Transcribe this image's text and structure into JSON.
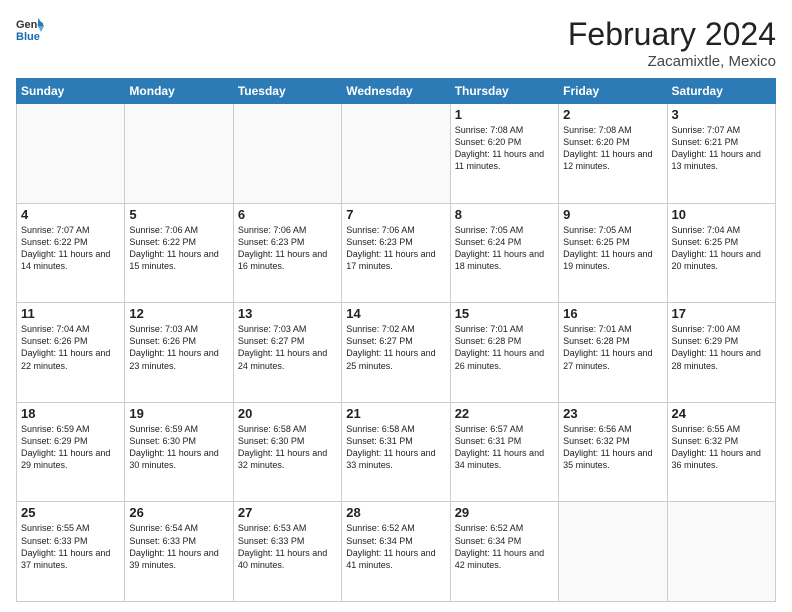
{
  "header": {
    "logo_general": "General",
    "logo_blue": "Blue",
    "month_year": "February 2024",
    "location": "Zacamixtle, Mexico"
  },
  "weekdays": [
    "Sunday",
    "Monday",
    "Tuesday",
    "Wednesday",
    "Thursday",
    "Friday",
    "Saturday"
  ],
  "weeks": [
    [
      {
        "day": "",
        "info": ""
      },
      {
        "day": "",
        "info": ""
      },
      {
        "day": "",
        "info": ""
      },
      {
        "day": "",
        "info": ""
      },
      {
        "day": "1",
        "info": "Sunrise: 7:08 AM\nSunset: 6:20 PM\nDaylight: 11 hours\nand 11 minutes."
      },
      {
        "day": "2",
        "info": "Sunrise: 7:08 AM\nSunset: 6:20 PM\nDaylight: 11 hours\nand 12 minutes."
      },
      {
        "day": "3",
        "info": "Sunrise: 7:07 AM\nSunset: 6:21 PM\nDaylight: 11 hours\nand 13 minutes."
      }
    ],
    [
      {
        "day": "4",
        "info": "Sunrise: 7:07 AM\nSunset: 6:22 PM\nDaylight: 11 hours\nand 14 minutes."
      },
      {
        "day": "5",
        "info": "Sunrise: 7:06 AM\nSunset: 6:22 PM\nDaylight: 11 hours\nand 15 minutes."
      },
      {
        "day": "6",
        "info": "Sunrise: 7:06 AM\nSunset: 6:23 PM\nDaylight: 11 hours\nand 16 minutes."
      },
      {
        "day": "7",
        "info": "Sunrise: 7:06 AM\nSunset: 6:23 PM\nDaylight: 11 hours\nand 17 minutes."
      },
      {
        "day": "8",
        "info": "Sunrise: 7:05 AM\nSunset: 6:24 PM\nDaylight: 11 hours\nand 18 minutes."
      },
      {
        "day": "9",
        "info": "Sunrise: 7:05 AM\nSunset: 6:25 PM\nDaylight: 11 hours\nand 19 minutes."
      },
      {
        "day": "10",
        "info": "Sunrise: 7:04 AM\nSunset: 6:25 PM\nDaylight: 11 hours\nand 20 minutes."
      }
    ],
    [
      {
        "day": "11",
        "info": "Sunrise: 7:04 AM\nSunset: 6:26 PM\nDaylight: 11 hours\nand 22 minutes."
      },
      {
        "day": "12",
        "info": "Sunrise: 7:03 AM\nSunset: 6:26 PM\nDaylight: 11 hours\nand 23 minutes."
      },
      {
        "day": "13",
        "info": "Sunrise: 7:03 AM\nSunset: 6:27 PM\nDaylight: 11 hours\nand 24 minutes."
      },
      {
        "day": "14",
        "info": "Sunrise: 7:02 AM\nSunset: 6:27 PM\nDaylight: 11 hours\nand 25 minutes."
      },
      {
        "day": "15",
        "info": "Sunrise: 7:01 AM\nSunset: 6:28 PM\nDaylight: 11 hours\nand 26 minutes."
      },
      {
        "day": "16",
        "info": "Sunrise: 7:01 AM\nSunset: 6:28 PM\nDaylight: 11 hours\nand 27 minutes."
      },
      {
        "day": "17",
        "info": "Sunrise: 7:00 AM\nSunset: 6:29 PM\nDaylight: 11 hours\nand 28 minutes."
      }
    ],
    [
      {
        "day": "18",
        "info": "Sunrise: 6:59 AM\nSunset: 6:29 PM\nDaylight: 11 hours\nand 29 minutes."
      },
      {
        "day": "19",
        "info": "Sunrise: 6:59 AM\nSunset: 6:30 PM\nDaylight: 11 hours\nand 30 minutes."
      },
      {
        "day": "20",
        "info": "Sunrise: 6:58 AM\nSunset: 6:30 PM\nDaylight: 11 hours\nand 32 minutes."
      },
      {
        "day": "21",
        "info": "Sunrise: 6:58 AM\nSunset: 6:31 PM\nDaylight: 11 hours\nand 33 minutes."
      },
      {
        "day": "22",
        "info": "Sunrise: 6:57 AM\nSunset: 6:31 PM\nDaylight: 11 hours\nand 34 minutes."
      },
      {
        "day": "23",
        "info": "Sunrise: 6:56 AM\nSunset: 6:32 PM\nDaylight: 11 hours\nand 35 minutes."
      },
      {
        "day": "24",
        "info": "Sunrise: 6:55 AM\nSunset: 6:32 PM\nDaylight: 11 hours\nand 36 minutes."
      }
    ],
    [
      {
        "day": "25",
        "info": "Sunrise: 6:55 AM\nSunset: 6:33 PM\nDaylight: 11 hours\nand 37 minutes."
      },
      {
        "day": "26",
        "info": "Sunrise: 6:54 AM\nSunset: 6:33 PM\nDaylight: 11 hours\nand 39 minutes."
      },
      {
        "day": "27",
        "info": "Sunrise: 6:53 AM\nSunset: 6:33 PM\nDaylight: 11 hours\nand 40 minutes."
      },
      {
        "day": "28",
        "info": "Sunrise: 6:52 AM\nSunset: 6:34 PM\nDaylight: 11 hours\nand 41 minutes."
      },
      {
        "day": "29",
        "info": "Sunrise: 6:52 AM\nSunset: 6:34 PM\nDaylight: 11 hours\nand 42 minutes."
      },
      {
        "day": "",
        "info": ""
      },
      {
        "day": "",
        "info": ""
      }
    ]
  ]
}
